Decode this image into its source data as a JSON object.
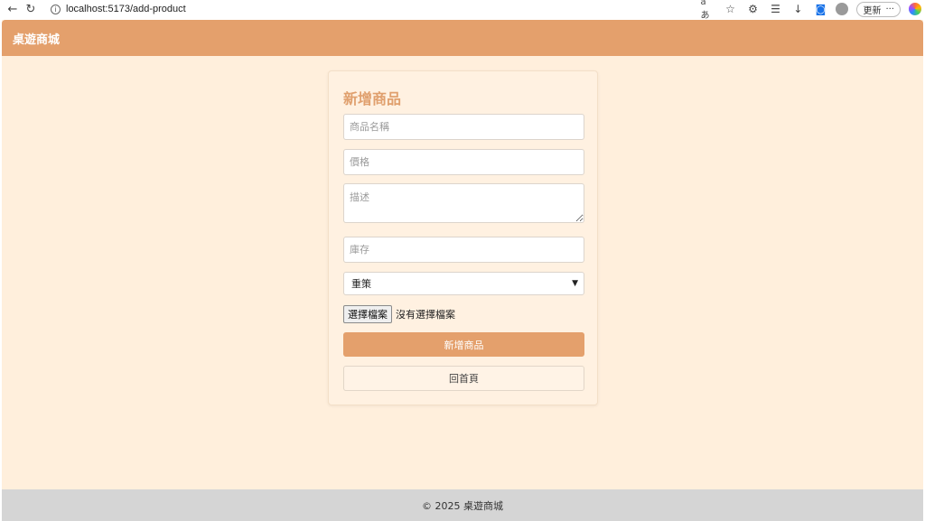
{
  "browser": {
    "url": "localhost:5173/add-product",
    "update_label": "更新",
    "more_label": "···"
  },
  "header": {
    "title": "桌遊商城"
  },
  "form": {
    "title": "新增商品",
    "name_placeholder": "商品名稱",
    "price_placeholder": "價格",
    "description_placeholder": "描述",
    "stock_placeholder": "庫存",
    "category_selected": "重策",
    "file_button_label": "選擇檔案",
    "file_status": "沒有選擇檔案",
    "submit_label": "新增商品",
    "home_label": "回首頁"
  },
  "footer": {
    "text": "© 2025 桌遊商城"
  },
  "colors": {
    "accent": "#e4a06c",
    "page_background": "#ffefdc",
    "footer_background": "#d5d5d5"
  }
}
